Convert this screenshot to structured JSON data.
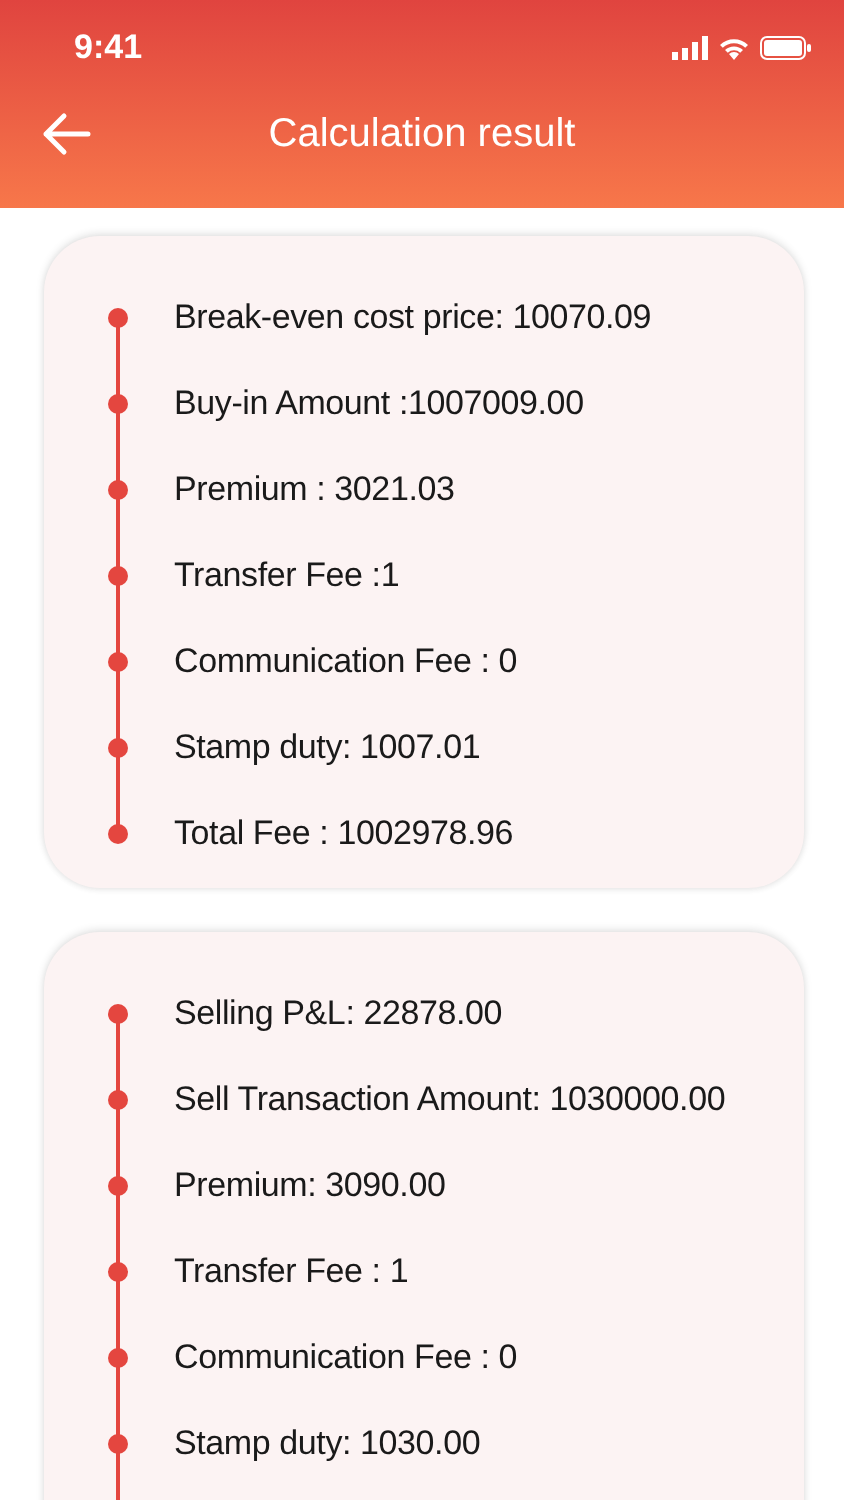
{
  "status_bar": {
    "time": "9:41"
  },
  "header": {
    "title": "Calculation result"
  },
  "cards": [
    {
      "items": [
        "Break-even cost price: 10070.09",
        "Buy-in Amount :1007009.00",
        "Premium : 3021.03",
        "Transfer Fee :1",
        "Communication Fee : 0",
        "Stamp duty: 1007.01",
        "Total Fee : 1002978.96"
      ]
    },
    {
      "items": [
        "Selling P&L: 22878.00",
        "Sell Transaction Amount: 1030000.00",
        "Premium: 3090.00",
        "Transfer Fee : 1",
        "Communication Fee : 0",
        "Stamp duty: 1030.00"
      ]
    }
  ]
}
